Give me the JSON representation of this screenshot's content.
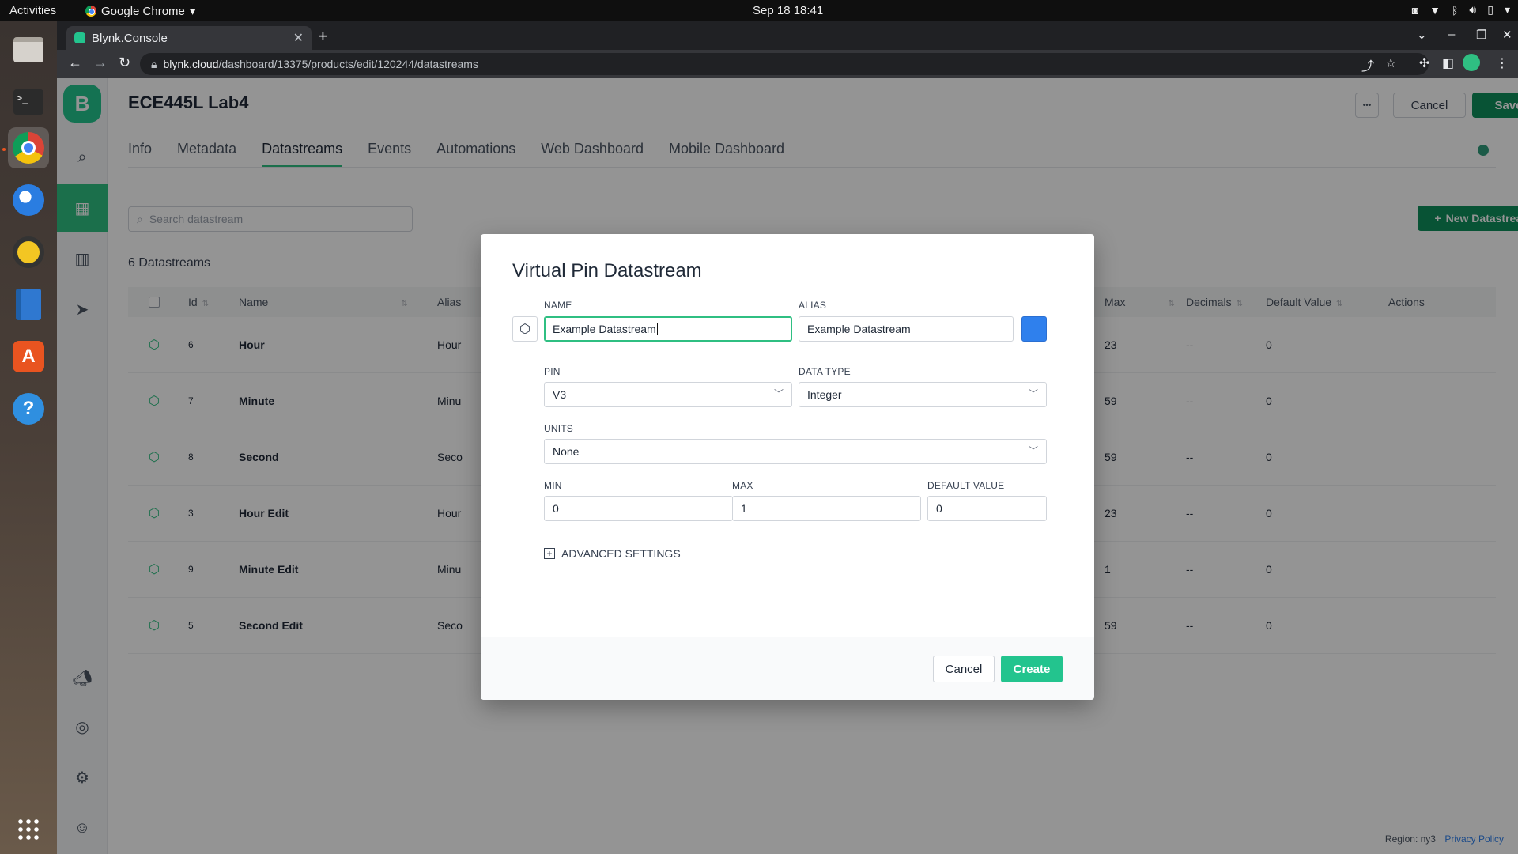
{
  "topbar": {
    "activities": "Activities",
    "app_name": "Google Chrome",
    "clock": "Sep 18  18:41"
  },
  "browser": {
    "tab_title": "Blynk.Console",
    "url_host": "blynk.cloud",
    "url_path": "/dashboard/13375/products/edit/120244/datastreams"
  },
  "page": {
    "product_title": "ECE445L Lab4",
    "header_buttons": {
      "more": "•••",
      "cancel": "Cancel",
      "save": "Save"
    },
    "tabs": [
      "Info",
      "Metadata",
      "Datastreams",
      "Events",
      "Automations",
      "Web Dashboard",
      "Mobile Dashboard"
    ],
    "active_tab": "Datastreams",
    "search_placeholder": "Search datastream",
    "new_datastream_label": "New Datastream",
    "datastream_count": "6 Datastreams",
    "table": {
      "headers": {
        "id": "Id",
        "name": "Name",
        "alias": "Alias",
        "max": "Max",
        "decimals": "Decimals",
        "default_value": "Default Value",
        "actions": "Actions"
      },
      "rows": [
        {
          "id": "6",
          "name": "Hour",
          "alias": "Hour",
          "max": "23",
          "decimals": "--",
          "default": "0"
        },
        {
          "id": "7",
          "name": "Minute",
          "alias": "Minu",
          "max": "59",
          "decimals": "--",
          "default": "0"
        },
        {
          "id": "8",
          "name": "Second",
          "alias": "Seco",
          "max": "59",
          "decimals": "--",
          "default": "0"
        },
        {
          "id": "3",
          "name": "Hour Edit",
          "alias": "Hour",
          "max": "23",
          "decimals": "--",
          "default": "0"
        },
        {
          "id": "9",
          "name": "Minute Edit",
          "alias": "Minu",
          "max": "1",
          "decimals": "--",
          "default": "0"
        },
        {
          "id": "5",
          "name": "Second Edit",
          "alias": "Seco",
          "max": "59",
          "decimals": "--",
          "default": "0"
        }
      ]
    },
    "footer": {
      "region": "Region: ny3",
      "privacy": "Privacy Policy"
    }
  },
  "modal": {
    "title": "Virtual Pin Datastream",
    "name_label": "NAME",
    "name_value": "Example Datastream",
    "alias_label": "ALIAS",
    "alias_value": "Example Datastream",
    "color": "#2f80ed",
    "pin_label": "PIN",
    "pin_value": "V3",
    "data_type_label": "DATA TYPE",
    "data_type_value": "Integer",
    "units_label": "UNITS",
    "units_value": "None",
    "min_label": "MIN",
    "min_value": "0",
    "max_label": "MAX",
    "max_value": "1",
    "default_label": "DEFAULT VALUE",
    "default_value": "0",
    "advanced_label": "ADVANCED SETTINGS",
    "cancel_label": "Cancel",
    "create_label": "Create"
  },
  "colors": {
    "brand_green": "#23c48e",
    "dark_green": "#0e8f5c"
  }
}
